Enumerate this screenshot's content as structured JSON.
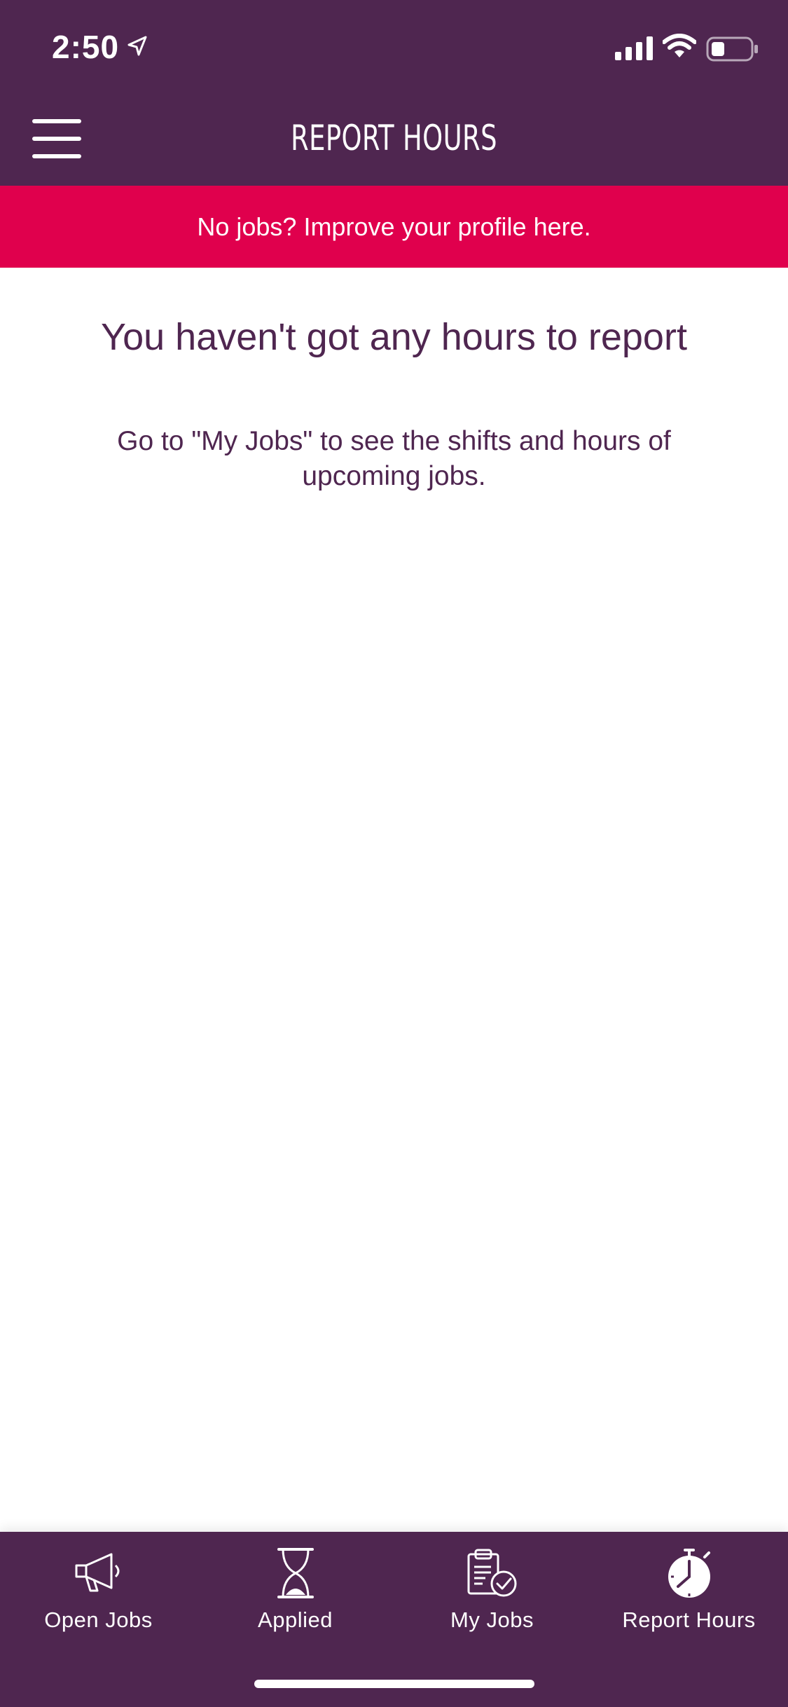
{
  "status_bar": {
    "time": "2:50",
    "icons": [
      "location-arrow-icon",
      "signal-icon",
      "wifi-icon",
      "battery-icon"
    ]
  },
  "header": {
    "title": "REPORT HOURS",
    "menu_icon": "hamburger-menu-icon"
  },
  "promo": {
    "text": "No jobs? Improve your profile here."
  },
  "empty_state": {
    "title": "You haven't got any hours to report",
    "message": "Go to \"My Jobs\" to see the shifts and hours of upcoming jobs."
  },
  "tabs": [
    {
      "label": "Open Jobs",
      "icon": "megaphone-icon"
    },
    {
      "label": "Applied",
      "icon": "hourglass-icon"
    },
    {
      "label": "My Jobs",
      "icon": "clipboard-check-icon"
    },
    {
      "label": "Report Hours",
      "icon": "stopwatch-icon",
      "active": true
    }
  ],
  "colors": {
    "brand": "#4f2650",
    "accent": "#e0004d",
    "background": "#ffffff"
  }
}
